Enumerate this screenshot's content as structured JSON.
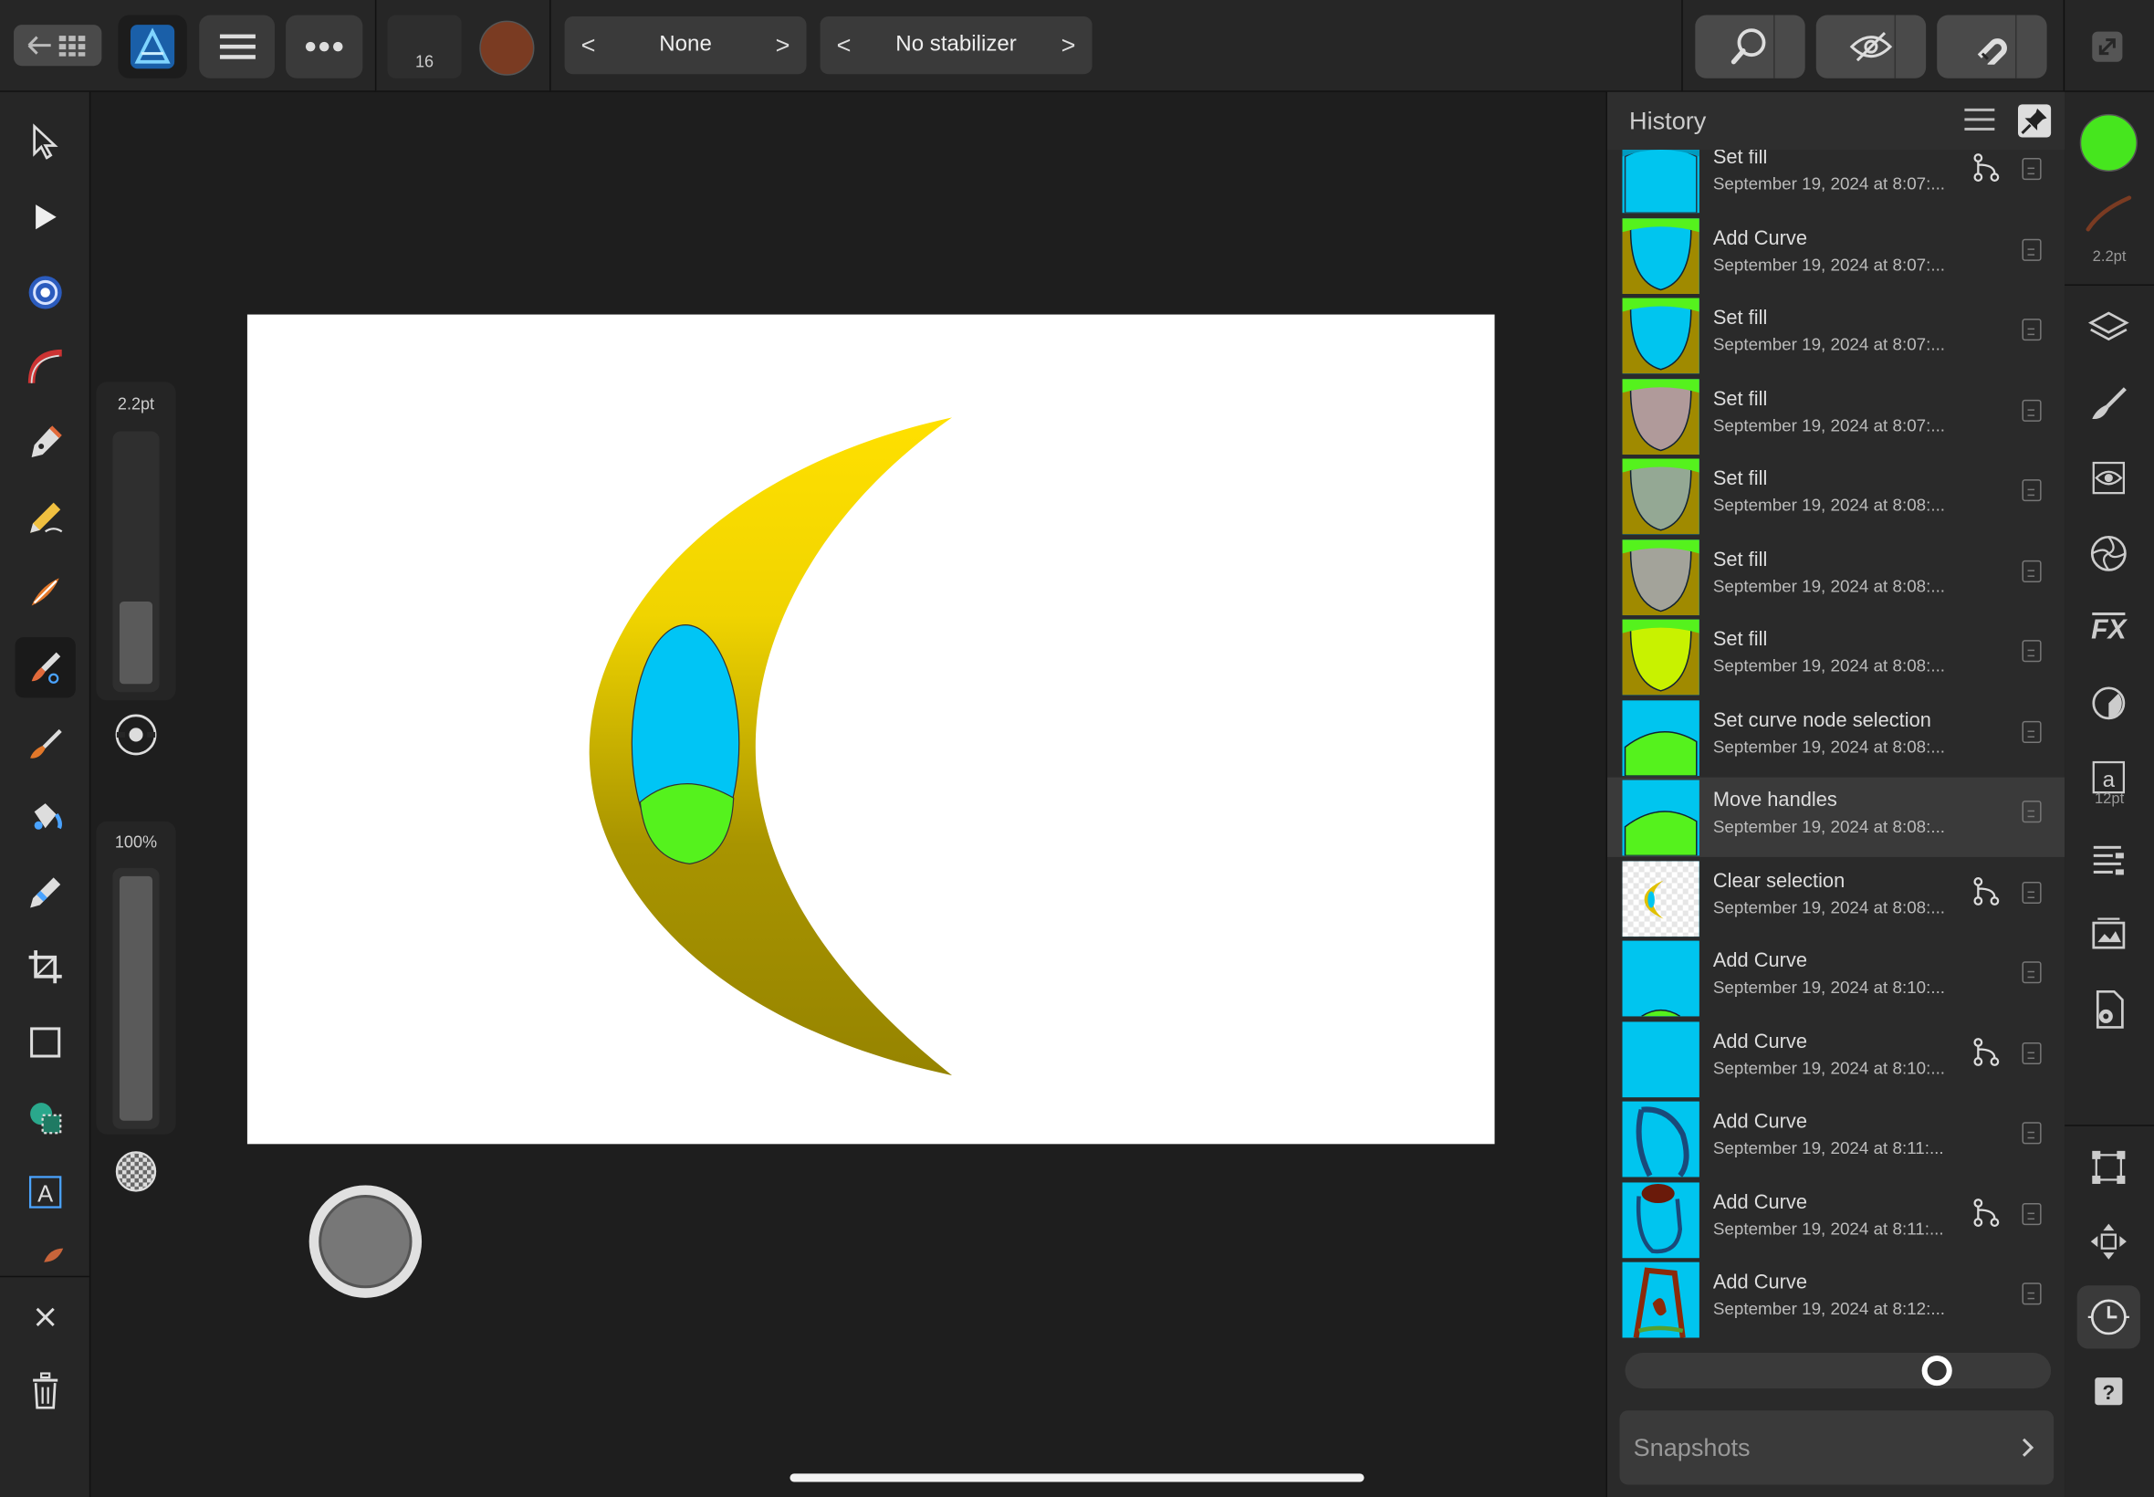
{
  "toolbar": {
    "brush_size_value": "16",
    "brush_color": "#7a3b22",
    "blend": {
      "label": "None",
      "prev": "<",
      "next": ">"
    },
    "stabilizer": {
      "label": "No stabilizer",
      "prev": "<",
      "next": ">"
    }
  },
  "left_sliders": {
    "width_label": "2.2pt",
    "opacity_label": "100%"
  },
  "history": {
    "title": "History",
    "items": [
      {
        "title": "Set fill",
        "date": "September 19, 2024 at 8:07:...",
        "branch": true,
        "thumb": "blue-cup"
      },
      {
        "title": "Add Curve",
        "date": "September 19, 2024 at 8:07:...",
        "branch": false,
        "thumb": "blue-olive"
      },
      {
        "title": "Set fill",
        "date": "September 19, 2024 at 8:07:...",
        "branch": false,
        "thumb": "blue-olive"
      },
      {
        "title": "Set fill",
        "date": "September 19, 2024 at 8:07:...",
        "branch": false,
        "thumb": "mauve-olive"
      },
      {
        "title": "Set fill",
        "date": "September 19, 2024 at 8:08:...",
        "branch": false,
        "thumb": "sage-olive"
      },
      {
        "title": "Set fill",
        "date": "September 19, 2024 at 8:08:...",
        "branch": false,
        "thumb": "grey-olive"
      },
      {
        "title": "Set fill",
        "date": "September 19, 2024 at 8:08:...",
        "branch": false,
        "thumb": "lime-olive"
      },
      {
        "title": "Set curve node selection",
        "date": "September 19, 2024 at 8:08:...",
        "branch": false,
        "thumb": "blue-green"
      },
      {
        "title": "Move handles",
        "date": "September 19, 2024 at 8:08:...",
        "branch": false,
        "thumb": "blue-green",
        "selected": true
      },
      {
        "title": "Clear selection",
        "date": "September 19, 2024 at 8:08:...",
        "branch": true,
        "thumb": "moon"
      },
      {
        "title": "Add Curve",
        "date": "September 19, 2024 at 8:10:...",
        "branch": false,
        "thumb": "blue-arc"
      },
      {
        "title": "Add Curve",
        "date": "September 19, 2024 at 8:10:...",
        "branch": true,
        "thumb": "blue"
      },
      {
        "title": "Add Curve",
        "date": "September 19, 2024 at 8:11:...",
        "branch": false,
        "thumb": "blue-outline"
      },
      {
        "title": "Add Curve",
        "date": "September 19, 2024 at 8:11:...",
        "branch": true,
        "thumb": "blue-head"
      },
      {
        "title": "Add Curve",
        "date": "September 19, 2024 at 8:12:...",
        "branch": false,
        "thumb": "blue-figure"
      }
    ],
    "scrubber_position": 0.94,
    "snapshots_label": "Snapshots"
  },
  "studio": {
    "primary_color": "#46e61e",
    "brush_width_label": "2.2pt",
    "text_size_label": "12pt"
  }
}
